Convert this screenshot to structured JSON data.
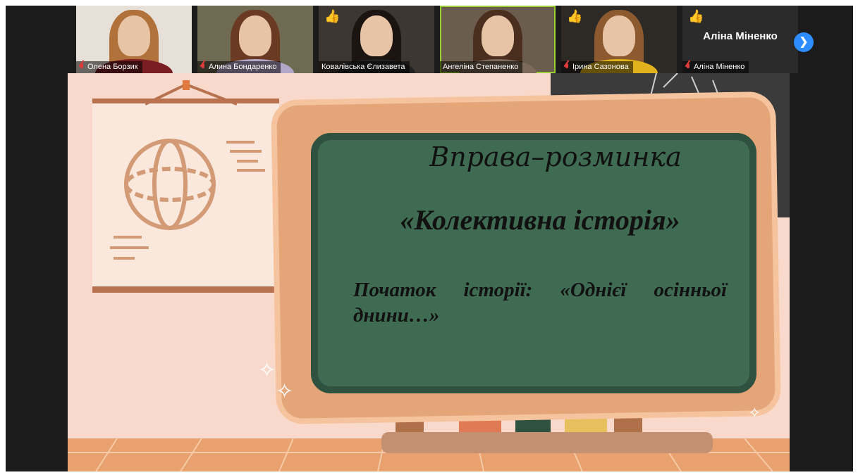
{
  "participants": [
    {
      "name": "Олена Борзик",
      "muted": true,
      "thumbs_up": false
    },
    {
      "name": "Алина Бондаренко",
      "muted": true,
      "thumbs_up": false
    },
    {
      "name": "Ковалівська Єлизавета",
      "muted": false,
      "thumbs_up": true
    },
    {
      "name": "Ангеліна Степаненко",
      "muted": false,
      "thumbs_up": false
    },
    {
      "name": "Ірина Сазонова",
      "muted": true,
      "thumbs_up": true
    },
    {
      "name": "Аліна Міненко",
      "muted": true,
      "thumbs_up": true,
      "title": "Аліна Міненко"
    }
  ],
  "controls": {
    "next_icon": "chevron-right-icon",
    "share_icon": "arrow-icon"
  },
  "slide": {
    "title": "Вправа–розминка",
    "subtitle": "«Колективна історія»",
    "body": "Початок історії: «Однієї осінньої днини…»"
  },
  "colors": {
    "accent": "#2d8cff",
    "board": "#3f6b52",
    "frame": "#e4a578",
    "wall": "#f8d9cb"
  }
}
